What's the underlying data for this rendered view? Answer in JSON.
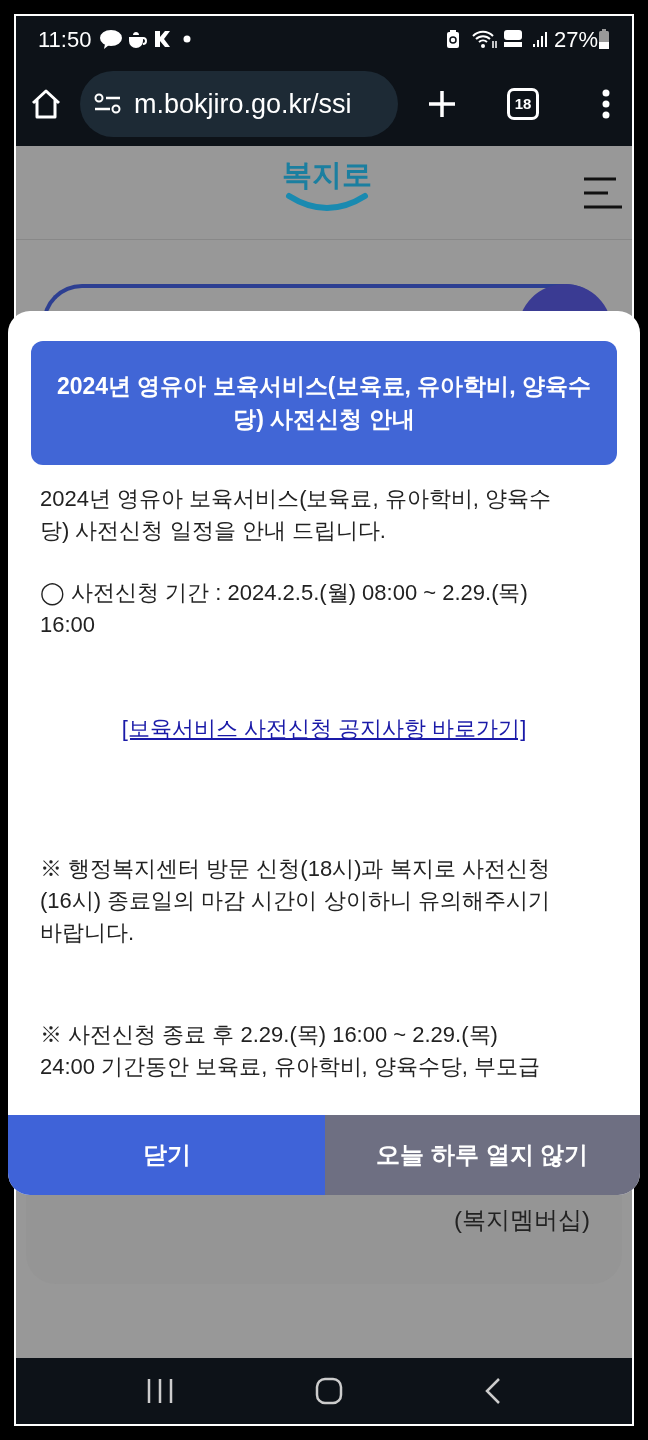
{
  "status_bar": {
    "time": "11:50",
    "battery": "27%"
  },
  "browser": {
    "url": "m.bokjiro.go.kr/ssi",
    "tab_count": "18"
  },
  "site_header": {
    "logo": "복지로"
  },
  "background_menu": {
    "item_label": "(복지멤버십)"
  },
  "popup": {
    "title_lines": [
      "2024년 영유아 보육서비스(보육료, 유아학비, 양육수",
      "당) 사전신청 안내"
    ],
    "blocks": [
      {
        "kind": "text",
        "lines": [
          "2024년 영유아 보육서비스(보육료, 유아학비, 양육수",
          "당) 사전신청 일정을 안내 드립니다."
        ]
      },
      {
        "kind": "text",
        "lines": [
          "◯ 사전신청 기간 : 2024.2.5.(월) 08:00 ~ 2.29.(목)",
          "16:00"
        ]
      },
      {
        "kind": "link",
        "lines": [
          "[보육서비스 사전신청 공지사항 바로가기]"
        ]
      },
      {
        "kind": "text",
        "lines": [
          "※ 행정복지센터 방문 신청(18시)과 복지로 사전신청",
          "(16시) 종료일의 마감 시간이 상이하니 유의해주시기",
          "바랍니다."
        ]
      },
      {
        "kind": "text",
        "lines": [
          "※ 사전신청 종료 후 2.29.(목) 16:00 ~ 2.29.(목)",
          "24:00 기간동안 보육료, 유아학비, 양육수당, 부모급"
        ]
      }
    ],
    "buttons": [
      {
        "label": "닫기",
        "kind": "primary"
      },
      {
        "label": "오늘 하루 열지 않기",
        "kind": "secondary"
      }
    ]
  }
}
